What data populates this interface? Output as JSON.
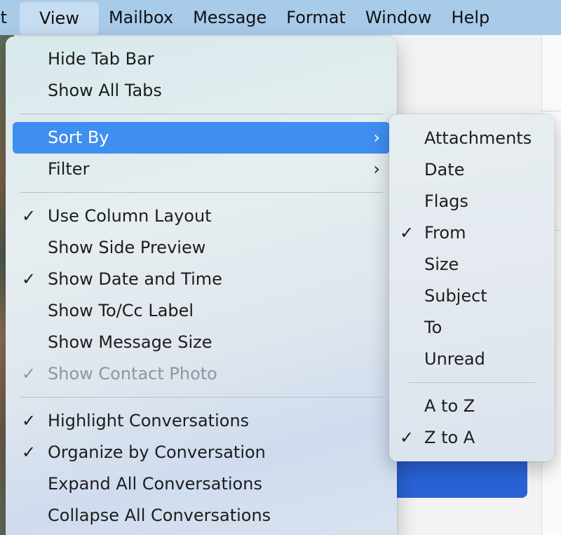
{
  "menubar": {
    "items": [
      {
        "label": "it"
      },
      {
        "label": "View"
      },
      {
        "label": "Mailbox"
      },
      {
        "label": "Message"
      },
      {
        "label": "Format"
      },
      {
        "label": "Window"
      },
      {
        "label": "Help"
      }
    ]
  },
  "view_menu": {
    "hide_tab_bar": "Hide Tab Bar",
    "show_all_tabs": "Show All Tabs",
    "sort_by": "Sort By",
    "filter": "Filter",
    "use_column_layout": "Use Column Layout",
    "show_side_preview": "Show Side Preview",
    "show_date_and_time": "Show Date and Time",
    "show_to_cc_label": "Show To/Cc Label",
    "show_message_size": "Show Message Size",
    "show_contact_photo": "Show Contact Photo",
    "highlight_conversations": "Highlight Conversations",
    "organize_by_conversation": "Organize by Conversation",
    "expand_all_conversations": "Expand All Conversations",
    "collapse_all_conversations": "Collapse All Conversations"
  },
  "sort_submenu": {
    "attachments": "Attachments",
    "date": "Date",
    "flags": "Flags",
    "from": "From",
    "size": "Size",
    "subject": "Subject",
    "to": "To",
    "unread": "Unread",
    "a_to_z": "A to Z",
    "z_to_a": "Z to A"
  },
  "glyphs": {
    "check": "✓",
    "chevron": "›"
  },
  "colors": {
    "menubar": "#a9cbea",
    "highlight": "#3f8ff0",
    "disabled_text": "#8f969c"
  }
}
